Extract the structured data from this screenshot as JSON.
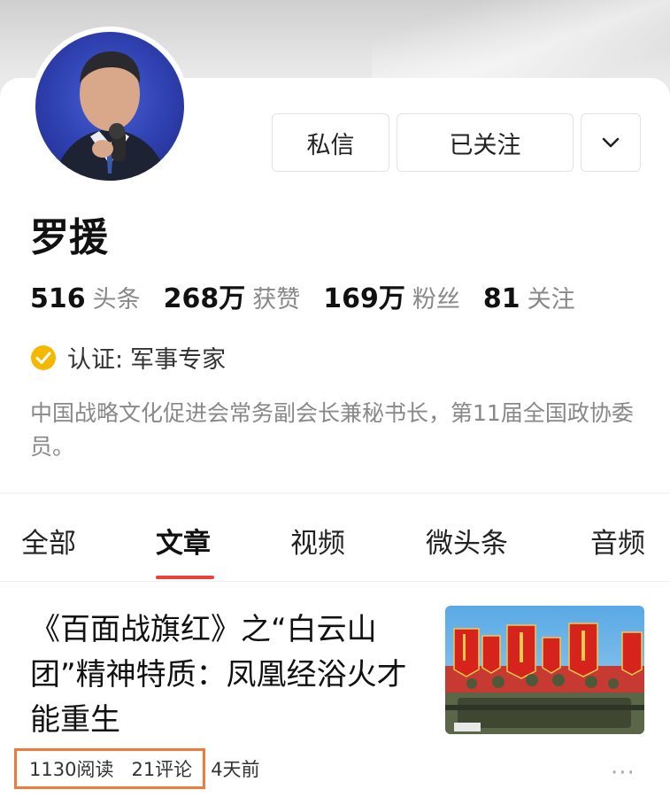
{
  "header": {
    "message_button": "私信",
    "follow_button": "已关注",
    "more_button_icon": "chevron-down-icon"
  },
  "profile": {
    "name": "罗援",
    "stats": [
      {
        "value": "516",
        "label": "头条"
      },
      {
        "value": "268万",
        "label": "获赞"
      },
      {
        "value": "169万",
        "label": "粉丝"
      },
      {
        "value": "81",
        "label": "关注"
      }
    ],
    "verification": {
      "icon": "verified-badge-icon",
      "label": "认证:",
      "value": "军事专家"
    },
    "bio": "中国战略文化促进会常务副会长兼秘书长，第11届全国政协委员。"
  },
  "tabs": [
    {
      "label": "全部"
    },
    {
      "label": "文章"
    },
    {
      "label": "视频"
    },
    {
      "label": "微头条"
    },
    {
      "label": "音频"
    }
  ],
  "active_tab": "文章",
  "article": {
    "title": "《百面战旗红》之“白云山团”精神特质：凤凰经浴火才能重生",
    "reads": "1130阅读",
    "comments": "21评论",
    "time": "4天前",
    "more_icon": "more-dots-icon"
  },
  "colors": {
    "accent": "#e8433b",
    "highlight_box": "#ef7a3a",
    "verify_badge": "#f5b800"
  }
}
